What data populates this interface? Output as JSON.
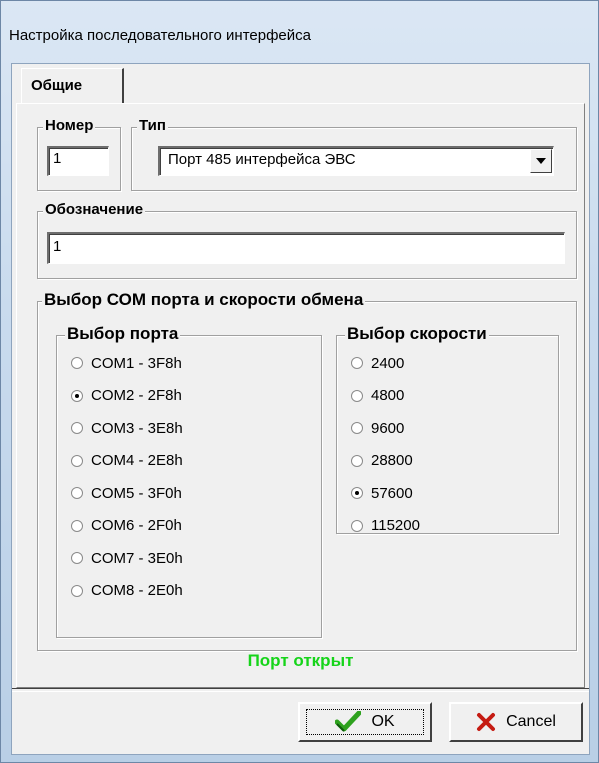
{
  "window": {
    "title": "Настройка последовательного интерфейса"
  },
  "tabs": [
    {
      "label": "Общие",
      "active": true
    }
  ],
  "number_group": {
    "legend": "Номер",
    "value": "1"
  },
  "type_group": {
    "legend": "Тип",
    "selected": "Порт 485 интерфейса ЭВС"
  },
  "designation_group": {
    "legend": "Обозначение",
    "value": "1"
  },
  "com_group": {
    "legend": "Выбор СОМ порта и скорости обмена",
    "port": {
      "legend": "Выбор порта",
      "options": [
        "COM1 - 3F8h",
        "COM2 - 2F8h",
        "COM3 - 3E8h",
        "COM4 - 2E8h",
        "COM5 - 3F0h",
        "COM6 - 2F0h",
        "COM7 - 3E0h",
        "COM8 - 2E0h"
      ],
      "selected_index": 1
    },
    "speed": {
      "legend": "Выбор скорости",
      "options": [
        "2400",
        "4800",
        "9600",
        "28800",
        "57600",
        "115200"
      ],
      "selected_index": 4
    }
  },
  "status": {
    "text": "Порт открыт",
    "color": "#16d41a"
  },
  "buttons": {
    "ok": "OK",
    "cancel": "Cancel"
  },
  "icons": {
    "ok": "check-icon",
    "cancel": "x-icon",
    "combo": "chevron-down-icon"
  }
}
